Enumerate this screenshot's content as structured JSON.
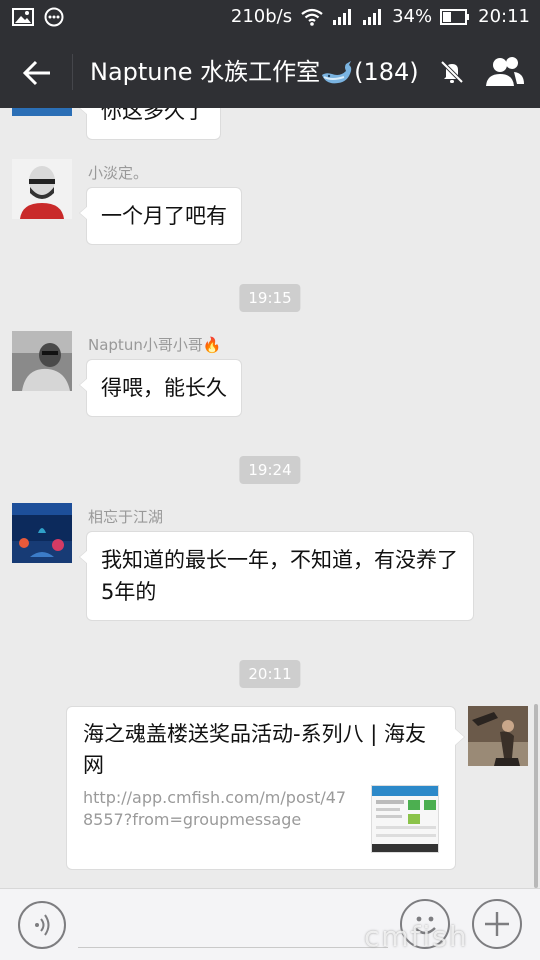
{
  "status_bar": {
    "speed": "210b/s",
    "battery": "34%",
    "time": "20:11"
  },
  "header": {
    "title": "Naptune 水族工作室",
    "count": "(184)"
  },
  "messages": [
    {
      "text": "你这多久了"
    },
    {
      "nickname": "小淡定。",
      "text": "一个月了吧有"
    },
    {
      "timestamp": "19:15"
    },
    {
      "nickname": "Naptun小哥小哥",
      "text": "得喂，能长久"
    },
    {
      "timestamp": "19:24"
    },
    {
      "nickname": "相忘于江湖",
      "text": "我知道的最长一年，不知道，有没养了5年的"
    },
    {
      "timestamp": "20:11"
    }
  ],
  "link_card": {
    "title": "海之魂盖楼送奖品活动-系列八 | 海友网",
    "url": "http://app.cmfish.com/m/post/478557?from=groupmessage"
  },
  "watermark": "cmfish",
  "colors": {
    "header_bg": "#2f3034",
    "chat_bg": "#ebebeb",
    "bubble_bg": "#ffffff",
    "timestamp_bg": "#cecece"
  }
}
